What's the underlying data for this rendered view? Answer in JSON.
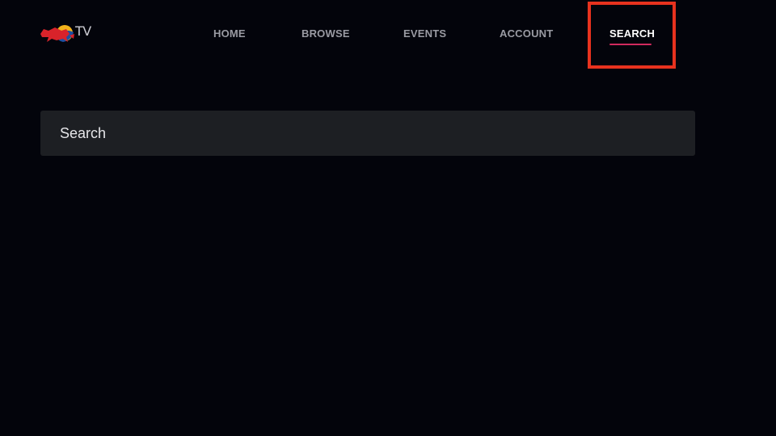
{
  "brand": {
    "logo_text": "TV",
    "accent_color": "#d12a5e",
    "highlight_color": "#e8321e"
  },
  "nav": {
    "items": [
      {
        "label": "HOME"
      },
      {
        "label": "BROWSE"
      },
      {
        "label": "EVENTS"
      },
      {
        "label": "ACCOUNT"
      },
      {
        "label": "SEARCH",
        "active": true
      }
    ]
  },
  "search": {
    "placeholder": "Search",
    "value": ""
  }
}
